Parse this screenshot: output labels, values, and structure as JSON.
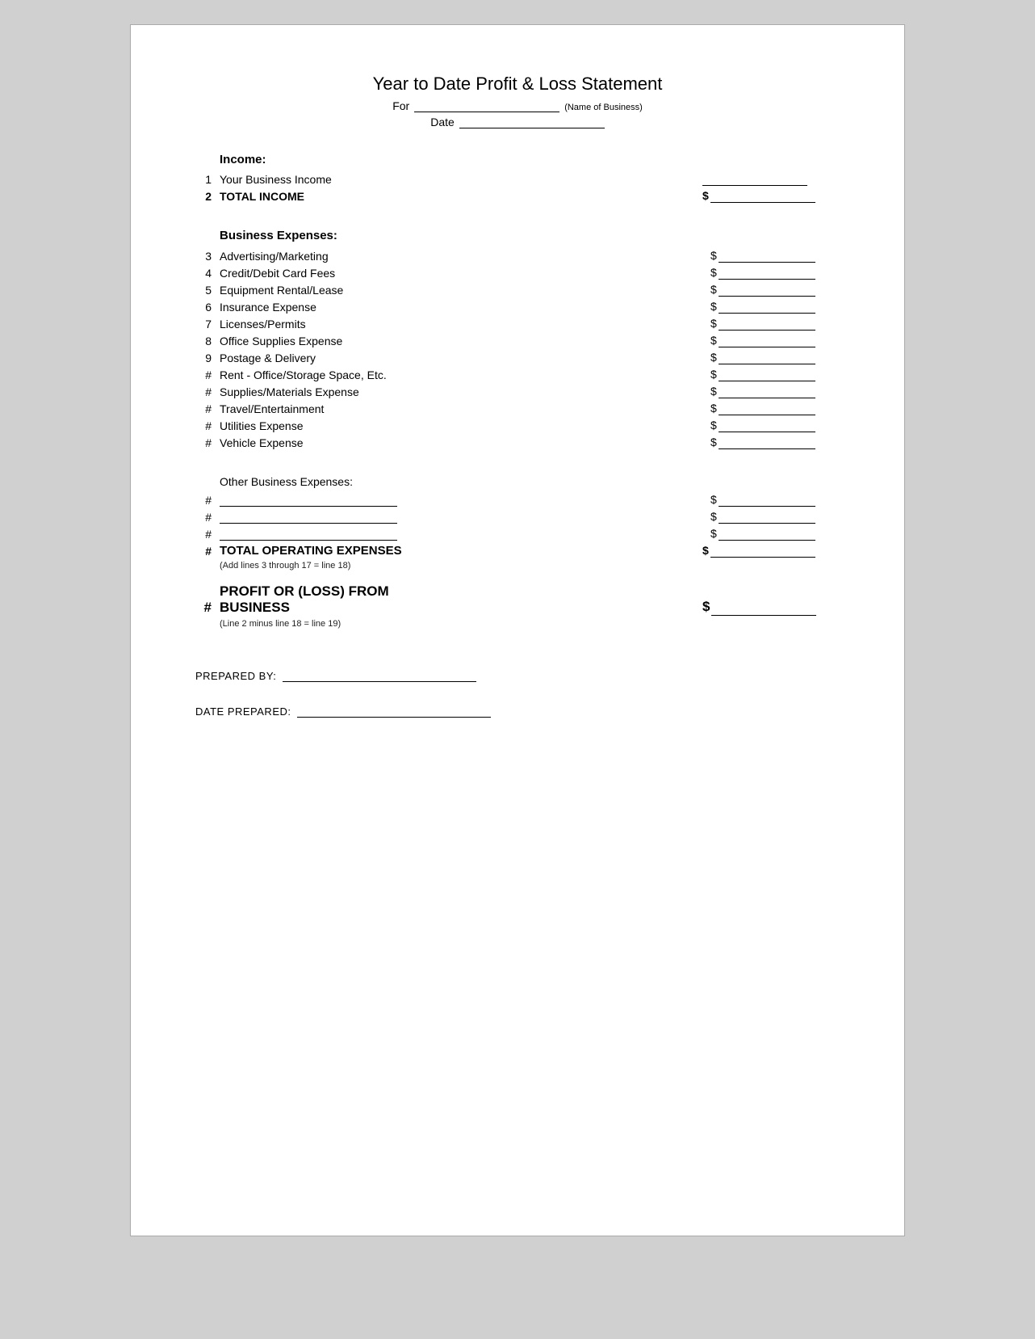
{
  "title": "Year to Date Profit & Loss Statement",
  "header": {
    "for_label": "For",
    "name_of_business_label": "(Name of Business)",
    "date_label": "Date"
  },
  "income_section": {
    "label": "Income:",
    "lines": [
      {
        "num": "1",
        "desc": "Your Business Income",
        "has_amount": false
      },
      {
        "num": "2",
        "desc": "TOTAL INCOME",
        "has_amount": true,
        "bold": true
      }
    ]
  },
  "expenses_section": {
    "label": "Business Expenses:",
    "lines": [
      {
        "num": "3",
        "desc": "Advertising/Marketing",
        "has_amount": true
      },
      {
        "num": "4",
        "desc": "Credit/Debit Card Fees",
        "has_amount": true
      },
      {
        "num": "5",
        "desc": "Equipment Rental/Lease",
        "has_amount": true
      },
      {
        "num": "6",
        "desc": "Insurance Expense",
        "has_amount": true
      },
      {
        "num": "7",
        "desc": "Licenses/Permits",
        "has_amount": true
      },
      {
        "num": "8",
        "desc": "Office Supplies Expense",
        "has_amount": true
      },
      {
        "num": "9",
        "desc": "Postage & Delivery",
        "has_amount": true
      },
      {
        "num": "#",
        "desc": "Rent - Office/Storage Space, Etc.",
        "has_amount": true
      },
      {
        "num": "#",
        "desc": "Supplies/Materials Expense",
        "has_amount": true
      },
      {
        "num": "#",
        "desc": "Travel/Entertainment",
        "has_amount": true
      },
      {
        "num": "#",
        "desc": "Utilities Expense",
        "has_amount": true
      },
      {
        "num": "#",
        "desc": "Vehicle Expense",
        "has_amount": true
      }
    ]
  },
  "other_expenses": {
    "label": "Other Business Expenses:",
    "lines": [
      {
        "num": "#"
      },
      {
        "num": "#"
      },
      {
        "num": "#"
      }
    ]
  },
  "total_operating": {
    "num": "#",
    "desc": "TOTAL OPERATING EXPENSES",
    "note": "(Add lines 3 through 17 = line 18)"
  },
  "profit_loss": {
    "num": "#",
    "desc": "PROFIT OR (LOSS) FROM BUSINESS",
    "note": "(Line 2 minus line 18 = line 19)"
  },
  "prepared_by": {
    "label": "PREPARED BY:"
  },
  "date_prepared": {
    "label": "DATE PREPARED:"
  }
}
